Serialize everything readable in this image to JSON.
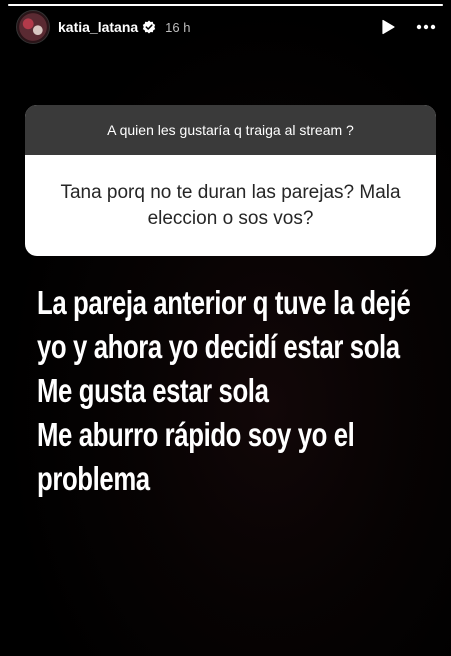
{
  "story": {
    "progress": 1.0
  },
  "header": {
    "username": "katia_latana",
    "time": "16 h",
    "verified_icon": "verified-badge-icon",
    "play_icon": "play-icon",
    "more_icon": "more-dots-icon"
  },
  "question_card": {
    "prompt": "A quien les gustaría q traiga al stream ?",
    "question": "Tana porq no te duran las parejas? Mala eleccion o sos vos?"
  },
  "answer": {
    "lines": [
      "La pareja anterior q tuve la dejé",
      "yo y ahora yo decidí estar sola",
      "Me gusta estar sola",
      "Me aburro rápido soy yo el",
      "problema"
    ]
  },
  "colors": {
    "card_header": "#3a3a3a",
    "card_body": "#ffffff",
    "background": "#000000"
  }
}
